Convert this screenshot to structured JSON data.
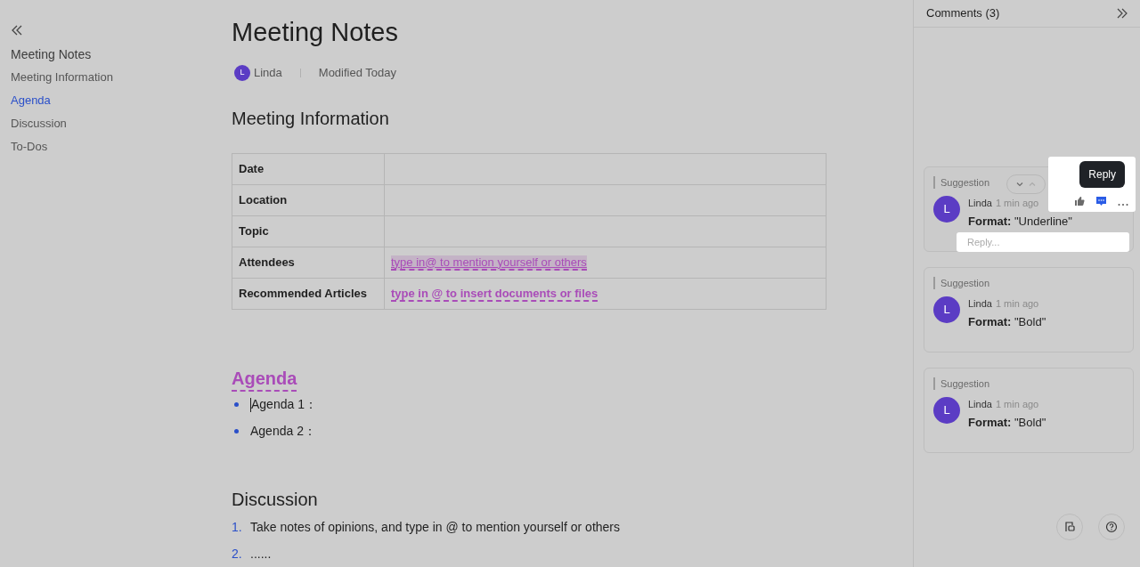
{
  "outline": {
    "items": [
      {
        "label": "Meeting Notes",
        "selected": false,
        "kind": "title"
      },
      {
        "label": "Meeting Information",
        "selected": false,
        "kind": "heading"
      },
      {
        "label": "Agenda",
        "selected": true,
        "kind": "heading"
      },
      {
        "label": "Discussion",
        "selected": false,
        "kind": "heading"
      },
      {
        "label": "To-Dos",
        "selected": false,
        "kind": "heading"
      }
    ]
  },
  "document": {
    "title": "Meeting Notes",
    "author": {
      "initial": "L",
      "name": "Linda"
    },
    "modified": "Modified Today",
    "sections": [
      {
        "kind": "table",
        "heading": "Meeting Information",
        "suggested": false,
        "rows": [
          {
            "label": "Date"
          },
          {
            "label": "Location"
          },
          {
            "label": "Topic"
          },
          {
            "label": "Attendees",
            "value": "type in@ to mention yourself or others",
            "highlighted": true,
            "bold": false
          },
          {
            "label": "Recommended Articles",
            "value": "type in @ to insert documents or files",
            "highlighted": false,
            "bold": true
          }
        ]
      },
      {
        "kind": "bullets",
        "heading": "Agenda",
        "suggested": true,
        "items": [
          "Agenda 1：",
          "Agenda 2："
        ]
      },
      {
        "kind": "numbered",
        "heading": "Discussion",
        "suggested": false,
        "items": [
          {
            "number": "1.",
            "text": "Take notes of opinions, and type in @ to mention yourself or others"
          },
          {
            "number": "2.",
            "text": "......"
          }
        ]
      }
    ]
  },
  "comments": {
    "title": "Comments (3)",
    "items": [
      {
        "label": "Suggestion",
        "author": "Linda",
        "initial": "L",
        "time": "1 min ago",
        "body": "**Format:** \"Underline\"",
        "active": true,
        "tooltip": "Reply",
        "reply_placeholder": "Reply..."
      },
      {
        "label": "Suggestion",
        "author": "Linda",
        "initial": "L",
        "time": "1 min ago",
        "body": "**Format:** \"Bold\"",
        "active": false
      },
      {
        "label": "Suggestion",
        "author": "Linda",
        "initial": "L",
        "time": "1 min ago",
        "body": "**Format:** \"Bold\"",
        "active": false
      }
    ]
  }
}
